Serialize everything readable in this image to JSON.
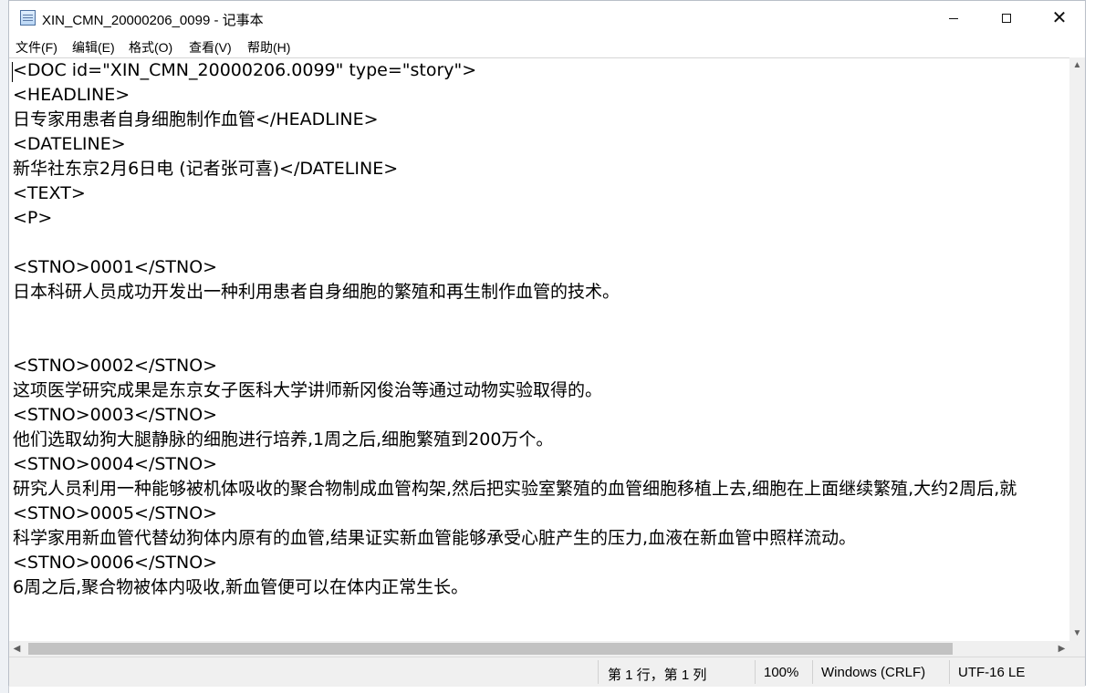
{
  "window": {
    "title": "XIN_CMN_20000206_0099 - 记事本",
    "icon": "notepad-icon",
    "controls": {
      "minimize": "minimize-icon",
      "maximize": "maximize-icon",
      "close": "close-icon"
    }
  },
  "menu": [
    "文件(F)",
    "编辑(E)",
    "格式(O)",
    "查看(V)",
    "帮助(H)"
  ],
  "editor": {
    "lines": [
      "<DOC id=\"XIN_CMN_20000206.0099\" type=\"story\">",
      "<HEADLINE>",
      "日专家用患者自身细胞制作血管</HEADLINE>",
      "<DATELINE>",
      "新华社东京2月6日电 (记者张可喜)</DATELINE>",
      "<TEXT>",
      "<P>",
      "",
      "<STNO>0001</STNO>",
      "日本科研人员成功开发出一种利用患者自身细胞的繁殖和再生制作血管的技术。",
      "",
      "",
      "<STNO>0002</STNO>",
      "这项医学研究成果是东京女子医科大学讲师新冈俊治等通过动物实验取得的。",
      "<STNO>0003</STNO>",
      "他们选取幼狗大腿静脉的细胞进行培养,1周之后,细胞繁殖到200万个。",
      "<STNO>0004</STNO>",
      "研究人员利用一种能够被机体吸收的聚合物制成血管构架,然后把实验室繁殖的血管细胞移植上去,细胞在上面继续繁殖,大约2周后,就",
      "<STNO>0005</STNO>",
      "科学家用新血管代替幼狗体内原有的血管,结果证实新血管能够承受心脏产生的压力,血液在新血管中照样流动。",
      "<STNO>0006</STNO>",
      "6周之后,聚合物被体内吸收,新血管便可以在体内正常生长。"
    ]
  },
  "statusbar": {
    "position": "第 1 行，第 1 列",
    "zoom": "100%",
    "line_ending": "Windows (CRLF)",
    "encoding": "UTF-16 LE"
  },
  "scrollbars": {
    "up": "▲",
    "down": "▼",
    "left": "◀",
    "right": "▶"
  }
}
